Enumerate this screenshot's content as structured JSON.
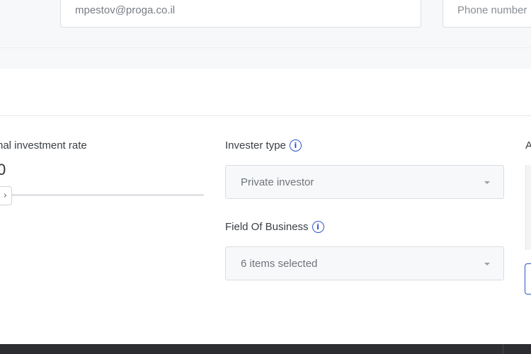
{
  "contact": {
    "email_value": "mpestov@proga.co.il",
    "phone_placeholder": "Phone number"
  },
  "investment": {
    "rate_label": "nal investment rate",
    "rate_value": "0"
  },
  "investor_type": {
    "label": "Invester type",
    "selected": "Private investor"
  },
  "field_of_business": {
    "label": "Field Of Business",
    "selected": "6 items selected"
  },
  "right_column": {
    "label_fragment": "A"
  },
  "icons": {
    "info": "info-icon",
    "slider": "chevron-right-icon",
    "dropdown": "caret-down-icon"
  },
  "colors": {
    "accent": "#2f54c8",
    "footer": "#2c2d30"
  }
}
